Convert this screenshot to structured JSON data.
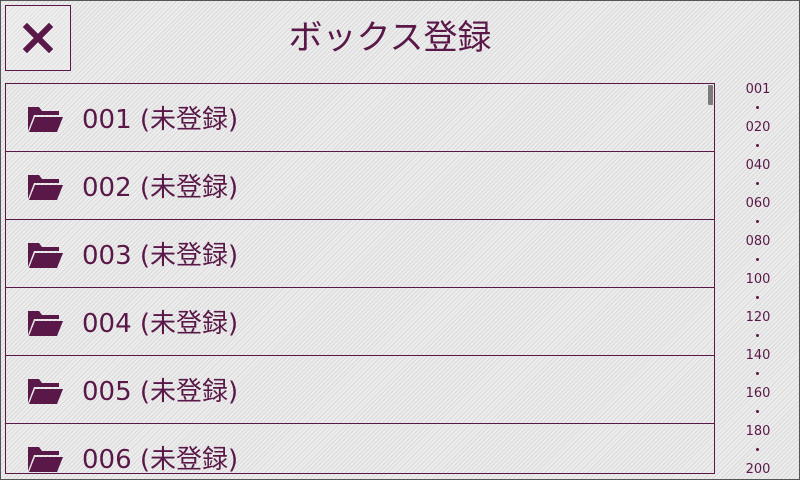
{
  "header": {
    "title": "ボックス登録",
    "close_icon": "close-icon"
  },
  "boxes": [
    {
      "label": "001 (未登録)",
      "icon": "folder-open-icon"
    },
    {
      "label": "002 (未登録)",
      "icon": "folder-open-icon"
    },
    {
      "label": "003 (未登録)",
      "icon": "folder-open-icon"
    },
    {
      "label": "004 (未登録)",
      "icon": "folder-open-icon"
    },
    {
      "label": "005 (未登録)",
      "icon": "folder-open-icon"
    },
    {
      "label": "006 (未登録)",
      "icon": "folder-open-icon"
    }
  ],
  "index": [
    "001",
    "020",
    "040",
    "060",
    "080",
    "100",
    "120",
    "140",
    "160",
    "180",
    "200"
  ],
  "colors": {
    "accent": "#5a1848",
    "background": "#e6e6e6",
    "scrollbar": "#7a7a7a"
  }
}
